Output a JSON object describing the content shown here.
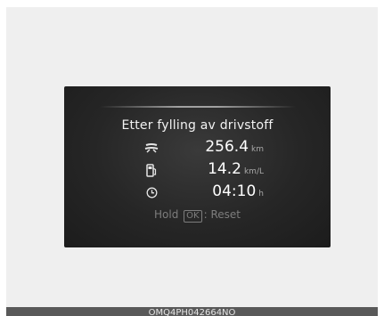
{
  "display": {
    "title": "Etter fylling av drivstoff",
    "rows": [
      {
        "icon": "distance-road-icon",
        "value": "256.4",
        "unit": "km"
      },
      {
        "icon": "fuel-pump-icon",
        "value": "14.2",
        "unit": "km/L"
      },
      {
        "icon": "clock-icon",
        "value": "04:10",
        "unit": "h"
      }
    ],
    "hint": {
      "prefix": "Hold",
      "key": "OK",
      "suffix": ": Reset"
    }
  },
  "caption": "OMQ4PH042664NO",
  "colors": {
    "screen": "#262626",
    "text": "#ffffff",
    "dim": "#7d7d7d",
    "frame": "#efefef",
    "caption_bar": "#595959"
  }
}
